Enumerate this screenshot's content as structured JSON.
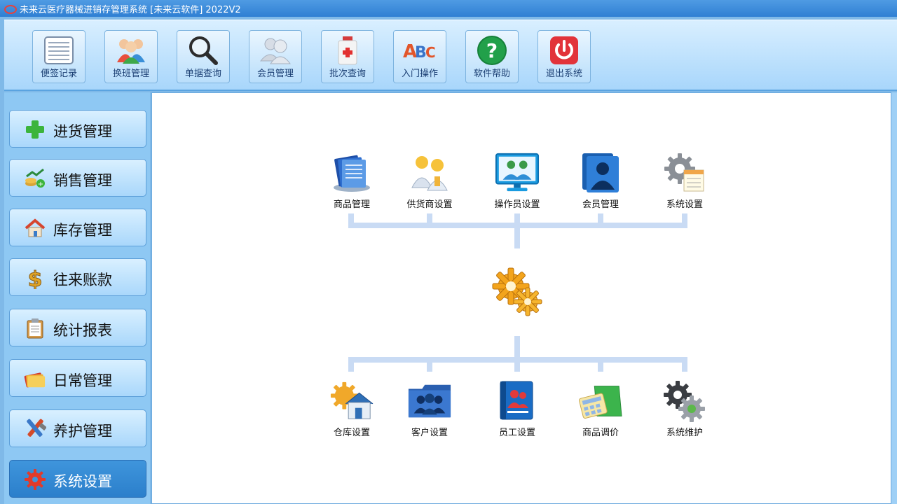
{
  "window": {
    "title": "未来云医疗器械进销存管理系统 [未来云软件] 2022V2"
  },
  "toolbar": {
    "items": [
      {
        "label": "便签记录",
        "icon": "notepad-icon"
      },
      {
        "label": "换班管理",
        "icon": "users-group-icon"
      },
      {
        "label": "单据查询",
        "icon": "magnifier-icon"
      },
      {
        "label": "会员管理",
        "icon": "members-icon"
      },
      {
        "label": "批次查询",
        "icon": "medicine-bottle-icon"
      },
      {
        "label": "入门操作",
        "icon": "abc-icon"
      },
      {
        "label": "软件帮助",
        "icon": "help-question-icon"
      },
      {
        "label": "退出系统",
        "icon": "power-icon"
      }
    ]
  },
  "sidebar": {
    "items": [
      {
        "label": "进货管理",
        "icon": "green-plus-icon"
      },
      {
        "label": "销售管理",
        "icon": "money-chart-icon"
      },
      {
        "label": "库存管理",
        "icon": "house-icon"
      },
      {
        "label": "往来账款",
        "icon": "dollar-icon"
      },
      {
        "label": "统计报表",
        "icon": "clipboard-icon"
      },
      {
        "label": "日常管理",
        "icon": "folders-icon"
      },
      {
        "label": "养护管理",
        "icon": "tools-icon"
      },
      {
        "label": "系统设置",
        "icon": "gear-icon",
        "active": true
      }
    ]
  },
  "main": {
    "top_nodes": [
      {
        "label": "商品管理",
        "icon": "product-stack-icon"
      },
      {
        "label": "供货商设置",
        "icon": "supplier-people-icon"
      },
      {
        "label": "操作员设置",
        "icon": "operator-monitor-icon"
      },
      {
        "label": "会员管理",
        "icon": "member-portrait-icon"
      },
      {
        "label": "系统设置",
        "icon": "settings-gear-doc-icon"
      }
    ],
    "center": {
      "icon": "gears-center-icon"
    },
    "bottom_nodes": [
      {
        "label": "仓库设置",
        "icon": "warehouse-icon"
      },
      {
        "label": "客户设置",
        "icon": "customer-folder-icon"
      },
      {
        "label": "员工设置",
        "icon": "employee-book-icon"
      },
      {
        "label": "商品调价",
        "icon": "price-calculator-icon"
      },
      {
        "label": "系统维护",
        "icon": "maintenance-gears-icon"
      }
    ]
  },
  "colors": {
    "accent": "#2f7fd3",
    "active": "#3f95dc",
    "connector": "#c9dbf4"
  }
}
